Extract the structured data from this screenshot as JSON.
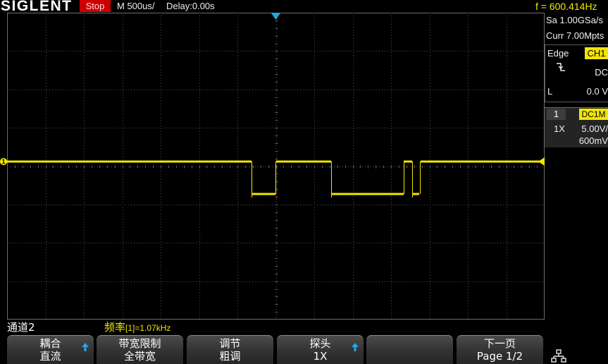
{
  "top_bar": {
    "brand": "SIGLENT",
    "run_state": "Stop",
    "timebase": "M 500us/",
    "delay": "Delay:0.00s",
    "frequency": "f = 600.414Hz"
  },
  "acquisition": {
    "sample_rate": "Sa 1.00GSa/s",
    "memory_depth": "Curr 7.00Mpts"
  },
  "trigger": {
    "type": "Edge",
    "source": "CH1",
    "coupling": "DC",
    "level_label": "L",
    "level": "0.0 V"
  },
  "channel": {
    "marker": "1",
    "number": "1",
    "coupling_impedance": "DC1M",
    "probe": "1X",
    "scale": "5.00V/",
    "offset": "600mV"
  },
  "status": {
    "menu_title": "通道2",
    "measurement_name": "频率",
    "measurement_value": "[1]=1.07kHz"
  },
  "softkeys": [
    {
      "title": "耦合",
      "value": "直流",
      "arrow": true
    },
    {
      "title": "带宽限制",
      "value": "全带宽",
      "arrow": false
    },
    {
      "title": "调节",
      "value": "粗调",
      "arrow": false
    },
    {
      "title": "探头",
      "value": "1X",
      "arrow": true
    },
    {
      "title": "",
      "value": "",
      "arrow": false
    },
    {
      "title": "下一页",
      "value": "Page 1/2",
      "arrow": false
    }
  ],
  "icons": {
    "trigger_slope": "falling-edge-icon",
    "trigger_position": "down-triangle-icon",
    "trigger_level_marker": "left-triangle-icon",
    "channel_marker": "channel-1-marker-icon",
    "softkey_arrow": "up-arrow-icon",
    "network": "network-icon"
  },
  "colors": {
    "channel1": "#f2e600",
    "trigger_position": "#27a4e5",
    "run_state_bg": "#cc0000",
    "softkey_arrow": "#27a4e5"
  }
}
